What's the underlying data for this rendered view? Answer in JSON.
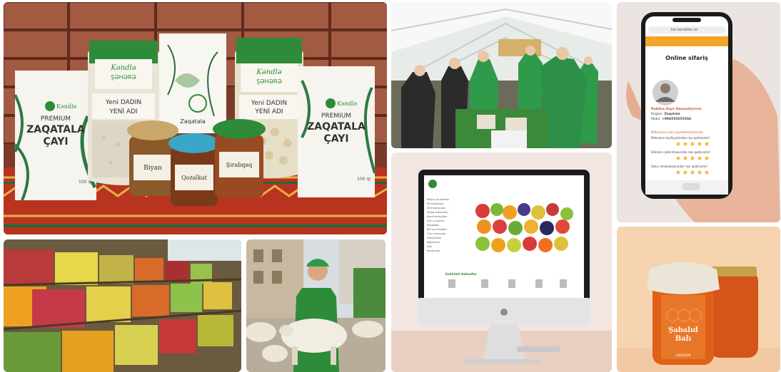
{
  "products": {
    "brand": "Kəndlə",
    "tea_left": {
      "title1": "PREMIUM",
      "title2": "ZAQATALA",
      "title3": "ÇAYI",
      "weight": "100 qr"
    },
    "tea_right": {
      "title1": "PREMIUM",
      "title2": "ZAQATALA",
      "title3": "ÇAYI",
      "weight": "100 qr"
    },
    "rice": {
      "brand": "Kəndlə",
      "brand2": "ŞƏHƏRƏ",
      "line1": "Yeni DADIN",
      "line2": "YENİ ADI"
    },
    "middle": {
      "line1": "Yeni DADIN",
      "line2": "YENİ ADI",
      "sub": "Zaqatala"
    },
    "nuts": {
      "brand": "Kəndlə",
      "brand2": "ŞƏHƏRƏ",
      "line1": "Yeni DADIN",
      "line2": "YENİ ADI"
    },
    "jar1": "Biyan",
    "jar2": "Qozalkat",
    "jar3": "Şırabqaq"
  },
  "phone": {
    "url": "kel.kendden.az",
    "title": "Online sifariş",
    "name": "Rabilna Zeya Qənnadiyevna",
    "region_label": "Region:",
    "region": "Zaqatala",
    "mobile_label": "Mobil:",
    "mobile": "+994555055566",
    "q0": "Məhsulunu necə qiymətləndirərsiniz",
    "q1": "Məhsulun keyfiyyətindən razı qaldınızmı?",
    "q2": "Sifarişin çatdırılmasından razı qaldınızmı?",
    "q3": "Satıcı əməkdaşlarından razı qaldınızmı?"
  },
  "honey": {
    "line1": "Şabalıd",
    "line2": "Balı",
    "sub": "KƏNDDƏN"
  },
  "monitor": {
    "section": "Endirimli məhsullar",
    "menu": [
      "Meyvə və tərəvəz",
      "Ət məhsulları",
      "Süd məhsulları",
      "Ərzaq məhsulları",
      "Kənd məhsulları",
      "Çay və qəhvə",
      "Balqabaq",
      "Bal və mürəbbə",
      "Quru meyvələr",
      "Ədviyyatlar",
      "Ağartılmış",
      "Qoz",
      "Konservlər"
    ]
  },
  "colors": {
    "brand_green": "#2e8b3a",
    "honey": "#d9641e",
    "phone_header": "#f2a527"
  }
}
